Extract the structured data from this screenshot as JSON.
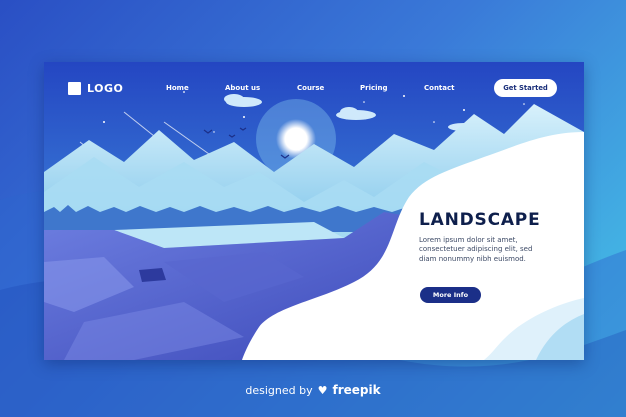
{
  "logo": {
    "text": "LOGO"
  },
  "nav": {
    "items": [
      "Home",
      "About us",
      "Course",
      "Pricing",
      "Contact"
    ],
    "cta_label": "Get Started"
  },
  "hero": {
    "title": "LANDSCAPE",
    "body": "Lorem ipsum dolor sit amet, consectetuer adipiscing elit, sed diam nonummy nibh euismod.",
    "button_label": "More Info"
  },
  "credit": {
    "prefix": "designed by",
    "brand": "freepik"
  },
  "colors": {
    "deep_blue": "#1b2f88",
    "title": "#0e1f4c",
    "sky_top": "#2446c2",
    "sky_bottom": "#5ab6e8"
  }
}
